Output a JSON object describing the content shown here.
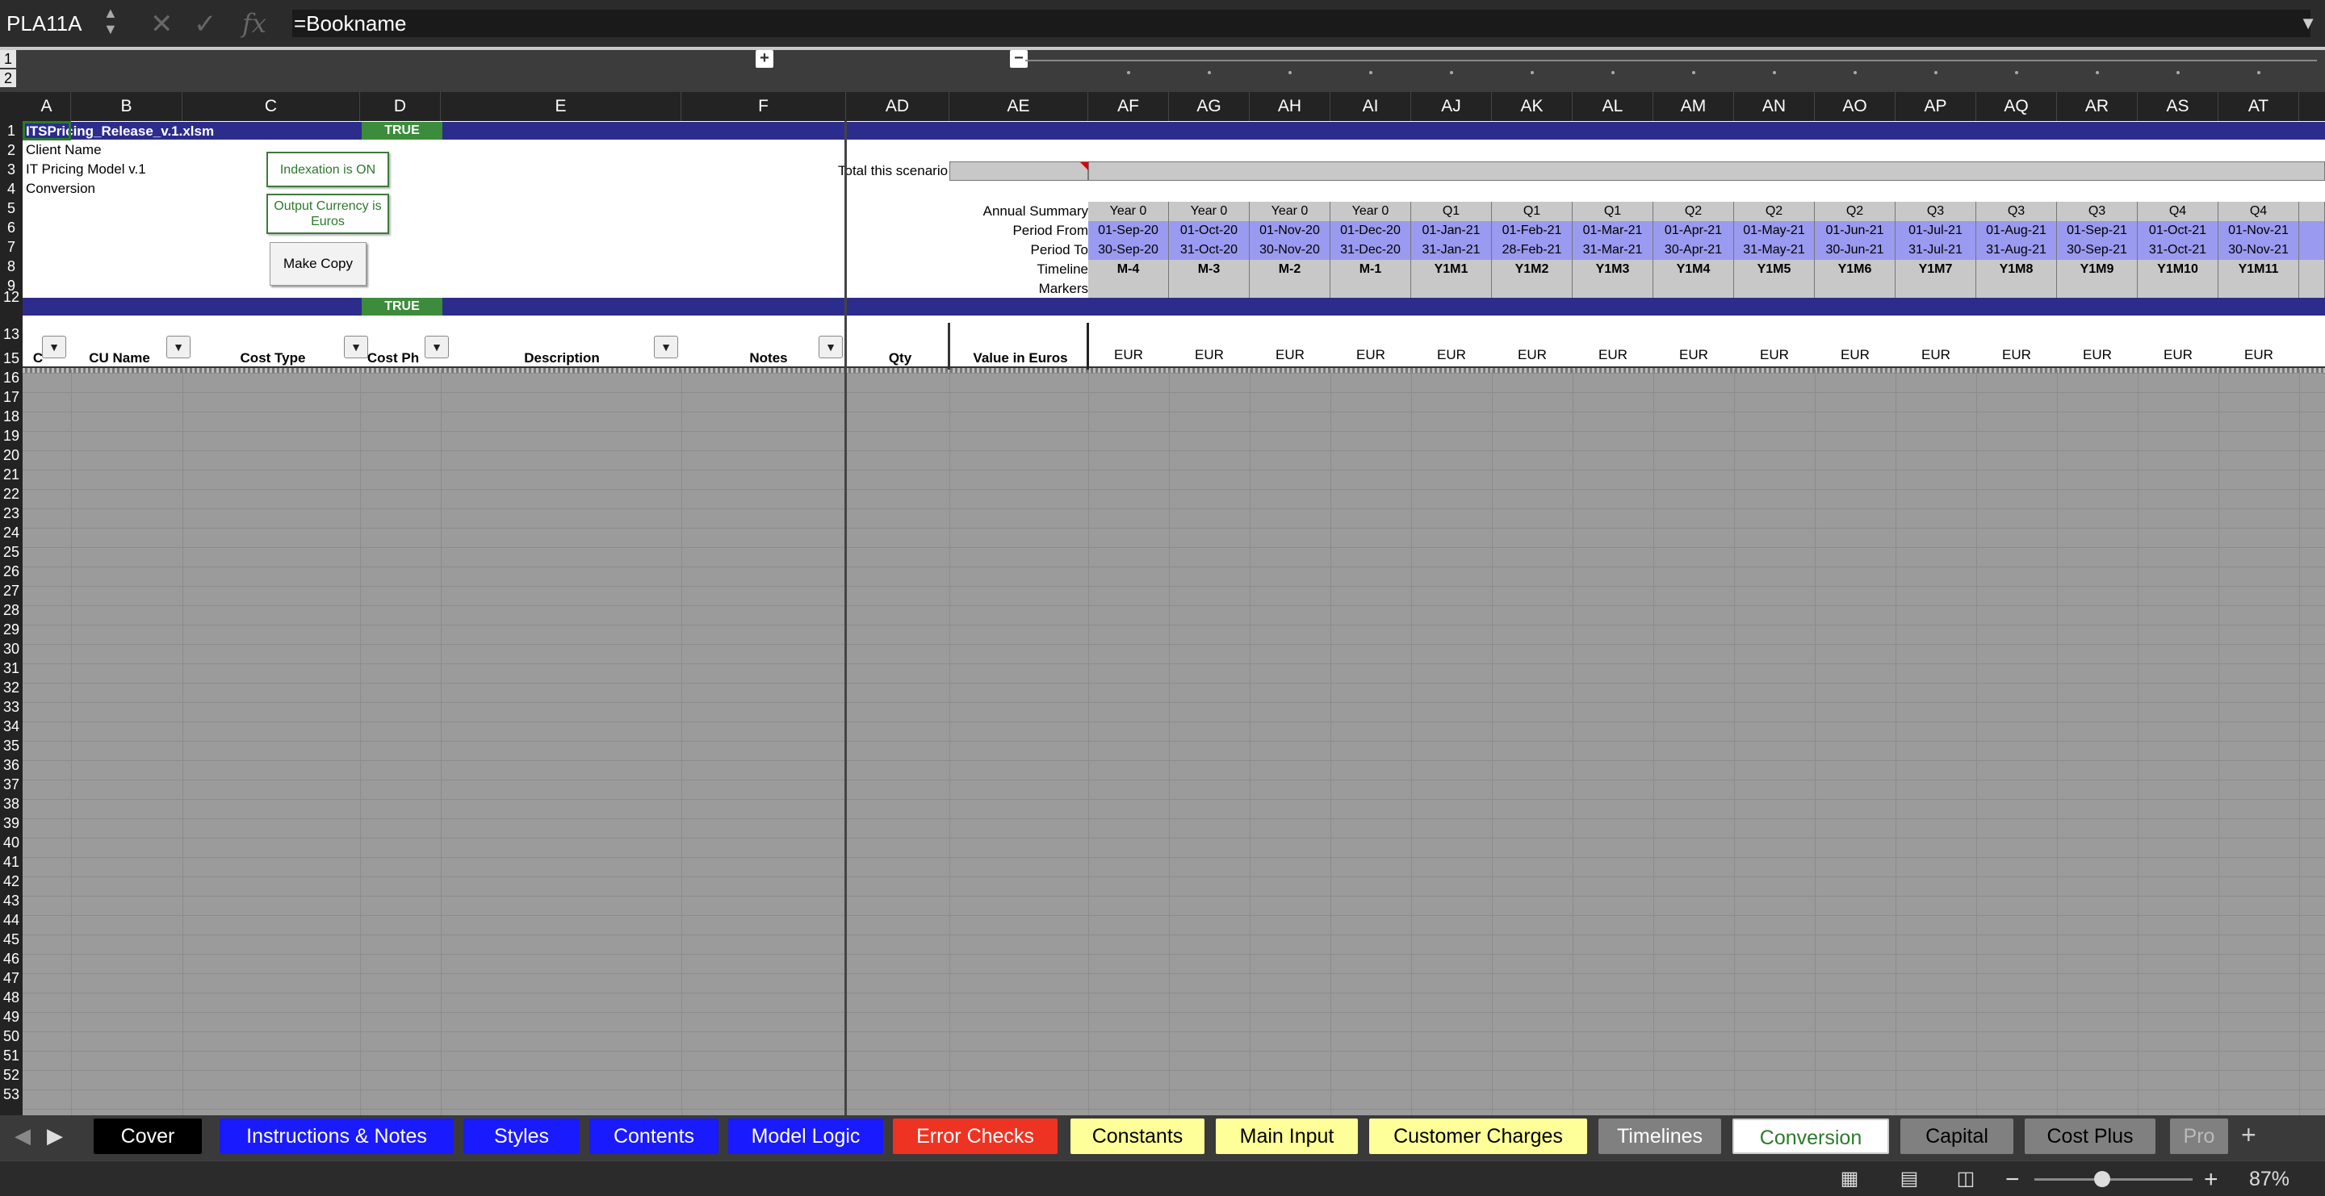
{
  "formula_bar": {
    "name_box": "PLA11A",
    "cancel_symbol": "✕",
    "confirm_symbol": "✓",
    "fx_symbol": "fx",
    "formula": "=Bookname"
  },
  "outline": {
    "levels": [
      "1",
      "2"
    ]
  },
  "columns": [
    "A",
    "B",
    "C",
    "D",
    "E",
    "F",
    "AD",
    "AE",
    "AF",
    "AG",
    "AH",
    "AI",
    "AJ",
    "AK",
    "AL",
    "AM",
    "AN",
    "AO",
    "AP",
    "AQ",
    "AR",
    "AS",
    "AT"
  ],
  "rows": [
    "1",
    "2",
    "3",
    "4",
    "5",
    "6",
    "7",
    "8",
    "9",
    "12",
    "13",
    "15",
    "16",
    "17",
    "18",
    "19",
    "20",
    "21",
    "22",
    "23",
    "24",
    "25",
    "26",
    "27",
    "28",
    "29",
    "30",
    "31",
    "32",
    "33",
    "34",
    "35",
    "36",
    "37",
    "38",
    "39",
    "40",
    "41",
    "42",
    "43",
    "44",
    "45",
    "46",
    "47",
    "48",
    "49",
    "50",
    "51",
    "52",
    "53"
  ],
  "sheet": {
    "file_name": "ITSPricing_Release_v.1.xlsm",
    "true_flag": "TRUE",
    "client_name": "Client Name",
    "model_name": "IT Pricing Model v.1",
    "sheet_label": "Conversion",
    "indexation_button": "Indexation is ON",
    "currency_button": "Output Currency is Euros",
    "copy_button": "Make Copy",
    "total_label": "Total this scenario",
    "row_labels": {
      "annual_summary": "Annual Summary",
      "period_from": "Period From",
      "period_to": "Period To",
      "timeline": "Timeline",
      "markers": "Markers"
    },
    "headers": {
      "col_a": "C",
      "cu_name": "CU Name",
      "cost_type": "Cost Type",
      "cost_ph": "Cost Ph",
      "description": "Description",
      "notes": "Notes",
      "qty": "Qty",
      "value_eur": "Value in Euros"
    },
    "currency_unit": "EUR",
    "timeline_columns": [
      {
        "summary": "Year 0",
        "from": "01-Sep-20",
        "to": "30-Sep-20",
        "timeline": "M-4"
      },
      {
        "summary": "Year 0",
        "from": "01-Oct-20",
        "to": "31-Oct-20",
        "timeline": "M-3"
      },
      {
        "summary": "Year 0",
        "from": "01-Nov-20",
        "to": "30-Nov-20",
        "timeline": "M-2"
      },
      {
        "summary": "Year 0",
        "from": "01-Dec-20",
        "to": "31-Dec-20",
        "timeline": "M-1"
      },
      {
        "summary": "Q1",
        "from": "01-Jan-21",
        "to": "31-Jan-21",
        "timeline": "Y1M1"
      },
      {
        "summary": "Q1",
        "from": "01-Feb-21",
        "to": "28-Feb-21",
        "timeline": "Y1M2"
      },
      {
        "summary": "Q1",
        "from": "01-Mar-21",
        "to": "31-Mar-21",
        "timeline": "Y1M3"
      },
      {
        "summary": "Q2",
        "from": "01-Apr-21",
        "to": "30-Apr-21",
        "timeline": "Y1M4"
      },
      {
        "summary": "Q2",
        "from": "01-May-21",
        "to": "31-May-21",
        "timeline": "Y1M5"
      },
      {
        "summary": "Q2",
        "from": "01-Jun-21",
        "to": "30-Jun-21",
        "timeline": "Y1M6"
      },
      {
        "summary": "Q3",
        "from": "01-Jul-21",
        "to": "31-Jul-21",
        "timeline": "Y1M7"
      },
      {
        "summary": "Q3",
        "from": "01-Aug-21",
        "to": "31-Aug-21",
        "timeline": "Y1M8"
      },
      {
        "summary": "Q3",
        "from": "01-Sep-21",
        "to": "30-Sep-21",
        "timeline": "Y1M9"
      },
      {
        "summary": "Q4",
        "from": "01-Oct-21",
        "to": "31-Oct-21",
        "timeline": "Y1M10"
      },
      {
        "summary": "Q4",
        "from": "01-Nov-21",
        "to": "30-Nov-21",
        "timeline": "Y1M11"
      }
    ]
  },
  "tabs": [
    {
      "label": "Cover",
      "bg": "#000000",
      "fg": "#ffffff"
    },
    {
      "label": "Instructions & Notes",
      "bg": "#1a1aff",
      "fg": "#ffffff"
    },
    {
      "label": "Styles",
      "bg": "#1a1aff",
      "fg": "#ffffff"
    },
    {
      "label": "Contents",
      "bg": "#1a1aff",
      "fg": "#ffffff"
    },
    {
      "label": "Model Logic",
      "bg": "#1a1aff",
      "fg": "#ffffff"
    },
    {
      "label": "Error Checks",
      "bg": "#ee3322",
      "fg": "#ffffff"
    },
    {
      "label": "Constants",
      "bg": "#ffff99",
      "fg": "#000000"
    },
    {
      "label": "Main Input",
      "bg": "#ffff99",
      "fg": "#000000"
    },
    {
      "label": "Customer Charges",
      "bg": "#ffff99",
      "fg": "#000000"
    },
    {
      "label": "Timelines",
      "bg": "#808080",
      "fg": "#ffffff"
    },
    {
      "label": "Conversion",
      "bg": "#ffffff",
      "fg": "#2d7a2d"
    },
    {
      "label": "Capital",
      "bg": "#808080",
      "fg": "#000000"
    },
    {
      "label": "Cost Plus",
      "bg": "#808080",
      "fg": "#000000"
    },
    {
      "label": "Pro",
      "bg": "#808080",
      "fg": "#bbbbbb"
    }
  ],
  "active_tab": "Conversion",
  "status": {
    "zoom": "87%"
  }
}
